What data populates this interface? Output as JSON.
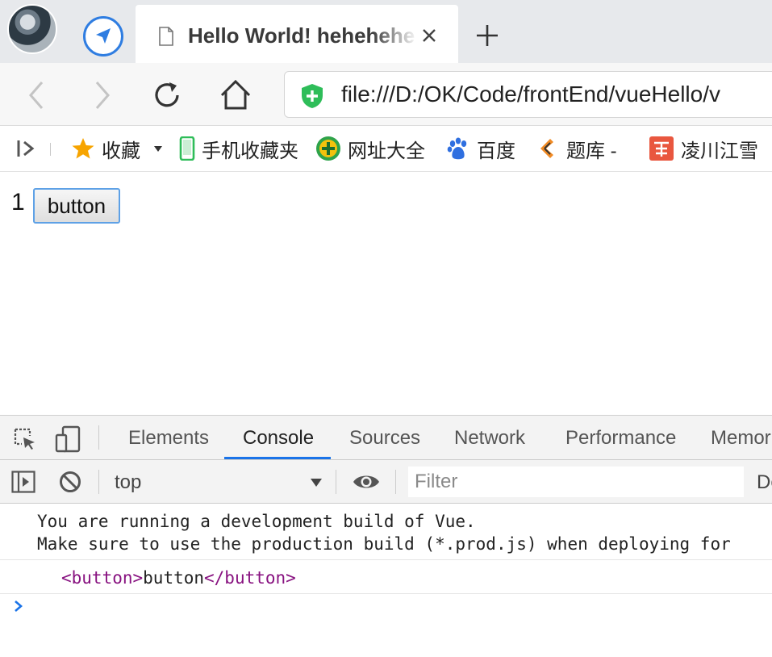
{
  "tab": {
    "title": "Hello World! hehehehe"
  },
  "toolbar": {
    "url": "file:///D:/OK/Code/frontEnd/vueHello/v"
  },
  "bookmarks": {
    "items": [
      {
        "label": "收藏",
        "icon": "star-icon"
      },
      {
        "label": "手机收藏夹",
        "icon": "phone-icon"
      },
      {
        "label": "网址大全",
        "icon": "green-plus-icon"
      },
      {
        "label": "百度",
        "icon": "baidu-paw-icon"
      },
      {
        "label": "题库 -",
        "icon": "tiku-icon"
      },
      {
        "label": "凌川江雪",
        "icon": "jian-icon"
      }
    ]
  },
  "page": {
    "counter": "1",
    "button_label": "button"
  },
  "devtools": {
    "tabs": [
      "Elements",
      "Console",
      "Sources",
      "Network",
      "Performance",
      "Memor"
    ],
    "active_tab": "Console",
    "context": "top",
    "filter_placeholder": "Filter",
    "levels_partial": "De",
    "console": {
      "message1_line1": "You are running a development build of Vue.",
      "message1_line2": "Make sure to use the production build (*.prod.js) when deploying for",
      "element_tag_open": "<button>",
      "element_text": "button",
      "element_tag_close": "</button>"
    }
  },
  "colors": {
    "accent": "#1a73e8",
    "tag": "#881280",
    "shield": "#2ebd59"
  }
}
